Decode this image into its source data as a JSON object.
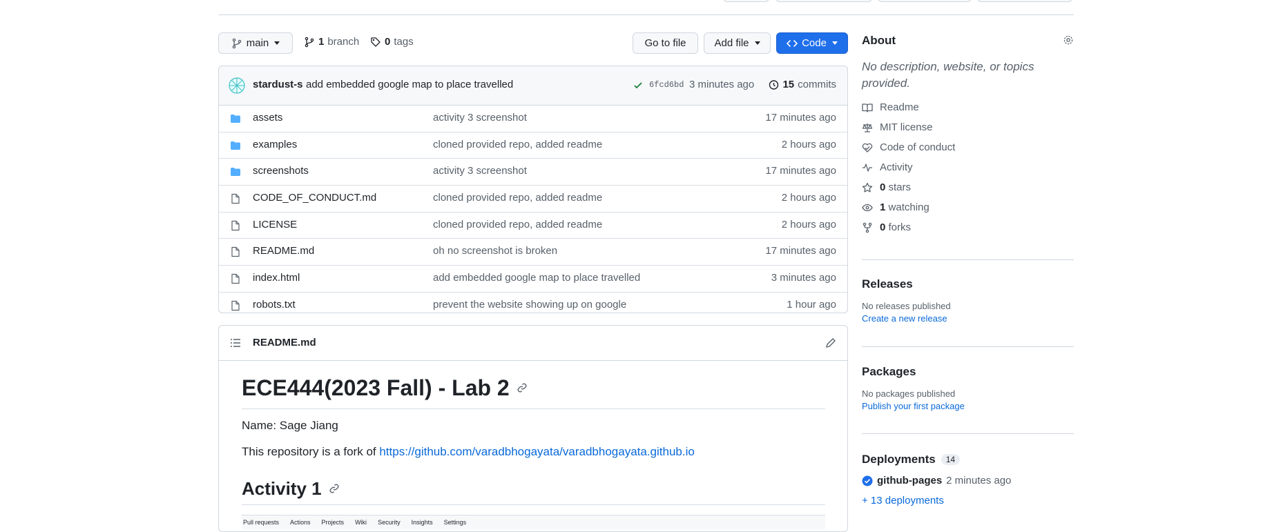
{
  "branch": {
    "name": "main",
    "count": "1",
    "count_label": "branch",
    "tags_count": "0",
    "tags_label": "tags"
  },
  "actions": {
    "go_to_file": "Go to file",
    "add_file": "Add file",
    "code": "Code"
  },
  "commit": {
    "author": "stardust-s",
    "message": "add embedded google map to place travelled",
    "hash": "6fcd6bd",
    "time": "3 minutes ago",
    "count": "15",
    "count_label": "commits"
  },
  "files": [
    {
      "type": "folder",
      "name": "assets",
      "message": "activity 3 screenshot",
      "time": "17 minutes ago"
    },
    {
      "type": "folder",
      "name": "examples",
      "message": "cloned provided repo, added readme",
      "time": "2 hours ago"
    },
    {
      "type": "folder",
      "name": "screenshots",
      "message": "activity 3 screenshot",
      "time": "17 minutes ago"
    },
    {
      "type": "file",
      "name": "CODE_OF_CONDUCT.md",
      "message": "cloned provided repo, added readme",
      "time": "2 hours ago"
    },
    {
      "type": "file",
      "name": "LICENSE",
      "message": "cloned provided repo, added readme",
      "time": "2 hours ago"
    },
    {
      "type": "file",
      "name": "README.md",
      "message": "oh no screenshot is broken",
      "time": "17 minutes ago"
    },
    {
      "type": "file",
      "name": "index.html",
      "message": "add embedded google map to place travelled",
      "time": "3 minutes ago"
    },
    {
      "type": "file",
      "name": "robots.txt",
      "message": "prevent the website showing up on google",
      "time": "1 hour ago"
    }
  ],
  "readme": {
    "filename": "README.md",
    "h1": "ECE444(2023 Fall) - Lab 2",
    "name_line": "Name: Sage Jiang",
    "fork_prefix": "This repository is a fork of ",
    "fork_link": "https://github.com/varadbhogayata/varadbhogayata.github.io",
    "h2": "Activity 1",
    "preview_tabs": [
      "Pull requests",
      "Actions",
      "Projects",
      "Wiki",
      "Security",
      "Insights",
      "Settings"
    ]
  },
  "about": {
    "title": "About",
    "description": "No description, website, or topics provided.",
    "items": [
      {
        "icon": "book-icon",
        "label": "Readme",
        "count": ""
      },
      {
        "icon": "scale-icon",
        "label": "MIT license",
        "count": ""
      },
      {
        "icon": "heart-hand-icon",
        "label": "Code of conduct",
        "count": ""
      },
      {
        "icon": "pulse-icon",
        "label": "Activity",
        "count": ""
      },
      {
        "icon": "star-icon",
        "label": "stars",
        "count": "0"
      },
      {
        "icon": "eye-icon",
        "label": "watching",
        "count": "1"
      },
      {
        "icon": "fork-icon",
        "label": "forks",
        "count": "0"
      }
    ]
  },
  "releases": {
    "title": "Releases",
    "empty": "No releases published",
    "link": "Create a new release"
  },
  "packages": {
    "title": "Packages",
    "empty": "No packages published",
    "link": "Publish your first package"
  },
  "deployments": {
    "title": "Deployments",
    "count": "14",
    "env": "github-pages",
    "time": "2 minutes ago",
    "more": "+ 13 deployments"
  },
  "colors": {
    "accent": "#0969da",
    "primary_button": "#1f6feb",
    "folder": "#54aeff",
    "success": "#1a7f37"
  }
}
